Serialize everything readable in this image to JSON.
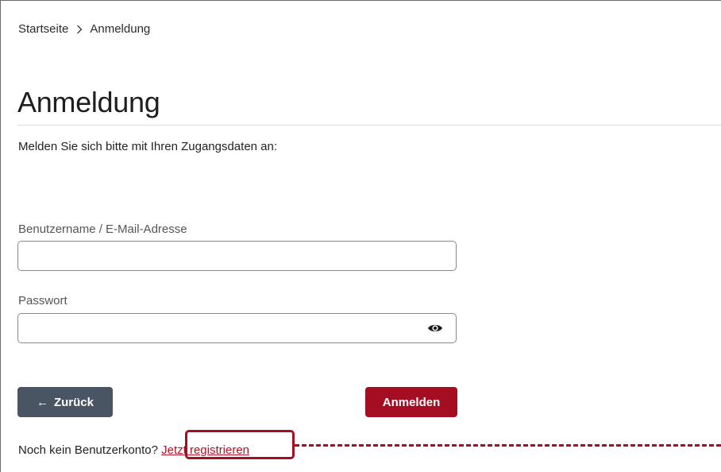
{
  "breadcrumb": {
    "home": "Startseite",
    "current": "Anmeldung"
  },
  "page": {
    "title": "Anmeldung",
    "intro": "Melden Sie sich bitte mit Ihren Zugangsdaten an:"
  },
  "form": {
    "username_label": "Benutzername / E-Mail-Adresse",
    "username_value": "",
    "password_label": "Passwort",
    "password_value": "",
    "password_toggle_icon": "eye-icon"
  },
  "buttons": {
    "back_arrow": "←",
    "back_label": "Zurück",
    "login_label": "Anmelden"
  },
  "register": {
    "prompt": "Noch kein Benutzerkonto?",
    "link_label": "Jetzt registrieren"
  },
  "colors": {
    "accent": "#a50e22",
    "back_button": "#4a5563",
    "highlight": "#a50e22"
  }
}
